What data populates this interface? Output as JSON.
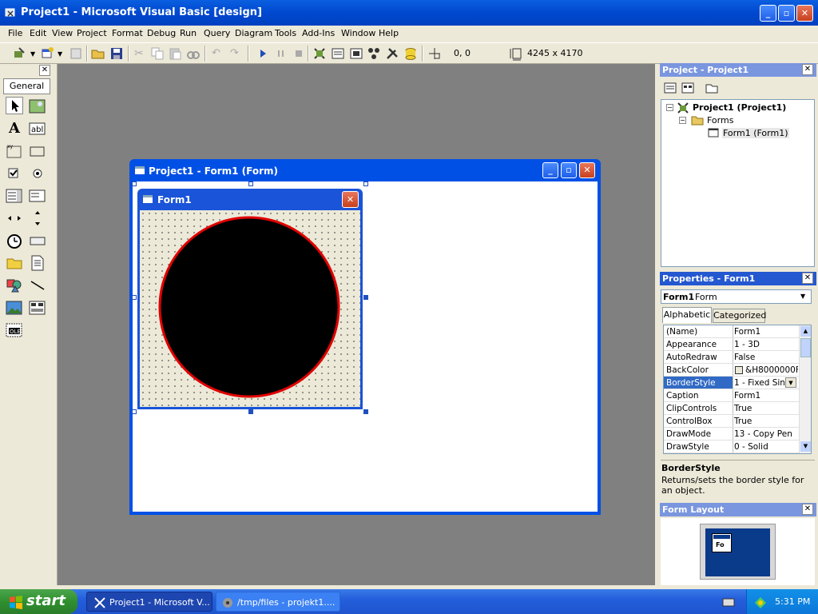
{
  "window": {
    "title": "Project1 - Microsoft Visual Basic [design]"
  },
  "menu": [
    "File",
    "Edit",
    "View",
    "Project",
    "Format",
    "Debug",
    "Run",
    "Query",
    "Diagram",
    "Tools",
    "Add-Ins",
    "Window",
    "Help"
  ],
  "toolbar": {
    "position": "0, 0",
    "size": "4245 x 4170"
  },
  "toolbox": {
    "tab": "General"
  },
  "designer": {
    "window_title": "Project1 - Form1 (Form)",
    "form_caption": "Form1",
    "circle": {
      "fill": "#000000",
      "border": "#e00000"
    }
  },
  "project_explorer": {
    "title": "Project - Project1",
    "root": "Project1 (Project1)",
    "folder": "Forms",
    "item": "Form1 (Form1)"
  },
  "properties": {
    "title": "Properties - Form1",
    "object_name": "Form1",
    "object_type": "Form",
    "tabs": [
      "Alphabetic",
      "Categorized"
    ],
    "rows": [
      {
        "name": "(Name)",
        "value": "Form1"
      },
      {
        "name": "Appearance",
        "value": "1 - 3D"
      },
      {
        "name": "AutoRedraw",
        "value": "False"
      },
      {
        "name": "BackColor",
        "value": "&H8000000F"
      },
      {
        "name": "BorderStyle",
        "value": "1 - Fixed Sin"
      },
      {
        "name": "Caption",
        "value": "Form1"
      },
      {
        "name": "ClipControls",
        "value": "True"
      },
      {
        "name": "ControlBox",
        "value": "True"
      },
      {
        "name": "DrawMode",
        "value": "13 - Copy Pen"
      },
      {
        "name": "DrawStyle",
        "value": "0 - Solid"
      }
    ],
    "selected": "BorderStyle",
    "description_title": "BorderStyle",
    "description_text": "Returns/sets the border style for an object."
  },
  "form_layout": {
    "title": "Form Layout",
    "thumb_label": "Fo"
  },
  "taskbar": {
    "start": "start",
    "tasks": [
      "Project1 - Microsoft V...",
      "/tmp/files - projekt1...."
    ],
    "clock": "5:31 PM"
  },
  "colors": {
    "xp_blue": "#0050e6",
    "selection": "#316ac5",
    "mdi_background": "#808080"
  }
}
